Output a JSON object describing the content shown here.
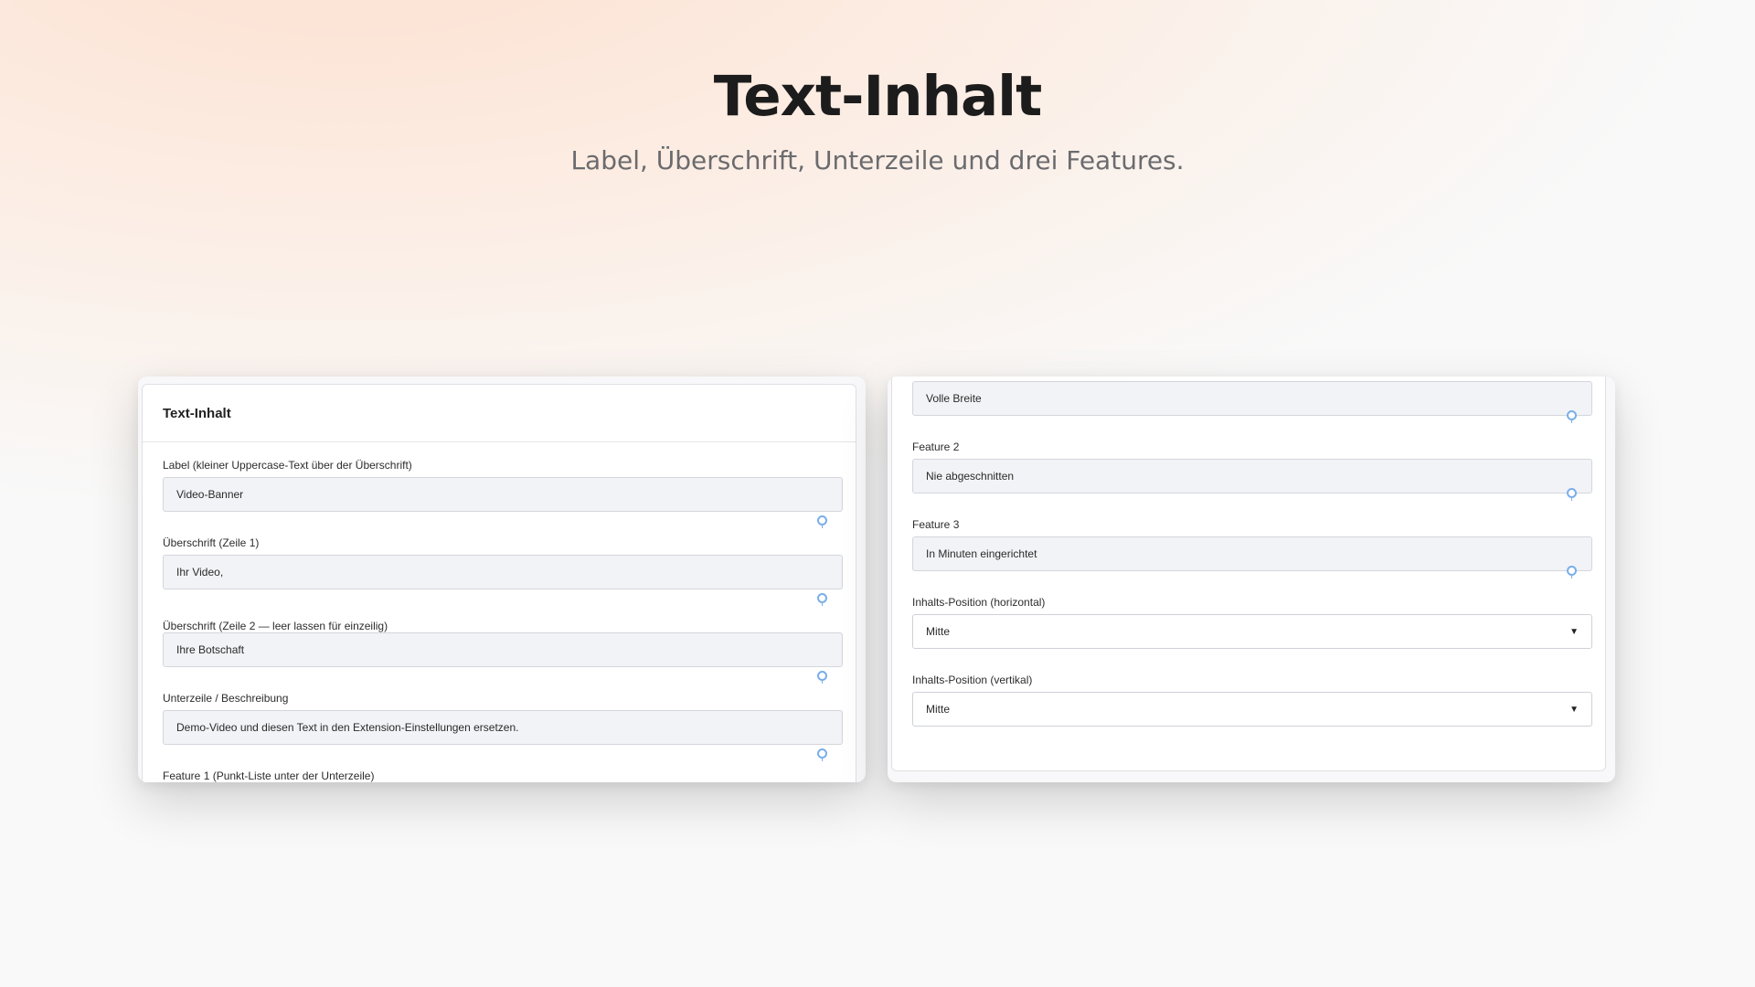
{
  "hero": {
    "title": "Text-Inhalt",
    "subtitle": "Label, Überschrift, Unterzeile und drei Features."
  },
  "left_panel": {
    "card_title": "Text-Inhalt",
    "fields": [
      {
        "label": "Label (kleiner Uppercase-Text über der Überschrift)",
        "value": "Video-Banner"
      },
      {
        "label": "Überschrift (Zeile 1)",
        "value": "Ihr Video,"
      },
      {
        "label": "Überschrift (Zeile 2 — leer lassen für einzeilig)",
        "value": "Ihre Botschaft"
      },
      {
        "label": "Unterzeile / Beschreibung",
        "value": "Demo-Video und diesen Text in den Extension-Einstellungen ersetzen."
      },
      {
        "label": "Feature 1 (Punkt-Liste unter der Unterzeile)"
      }
    ]
  },
  "right_panel": {
    "fields": [
      {
        "value": "Volle Breite"
      },
      {
        "label": "Feature 2",
        "value": "Nie abgeschnitten"
      },
      {
        "label": "Feature 3",
        "value": "In Minuten eingerichtet"
      }
    ],
    "selects": [
      {
        "label": "Inhalts-Position (horizontal)",
        "value": "Mitte"
      },
      {
        "label": "Inhalts-Position (vertikal)",
        "value": "Mitte"
      }
    ]
  },
  "colors": {
    "accent": "#7aaee8",
    "text": "#1c1c1c",
    "muted": "#6b6b6e",
    "input_bg": "#f2f3f7"
  },
  "icons": {
    "field_hint": "map-pin-icon",
    "select_arrow": "chevron-down-icon"
  }
}
